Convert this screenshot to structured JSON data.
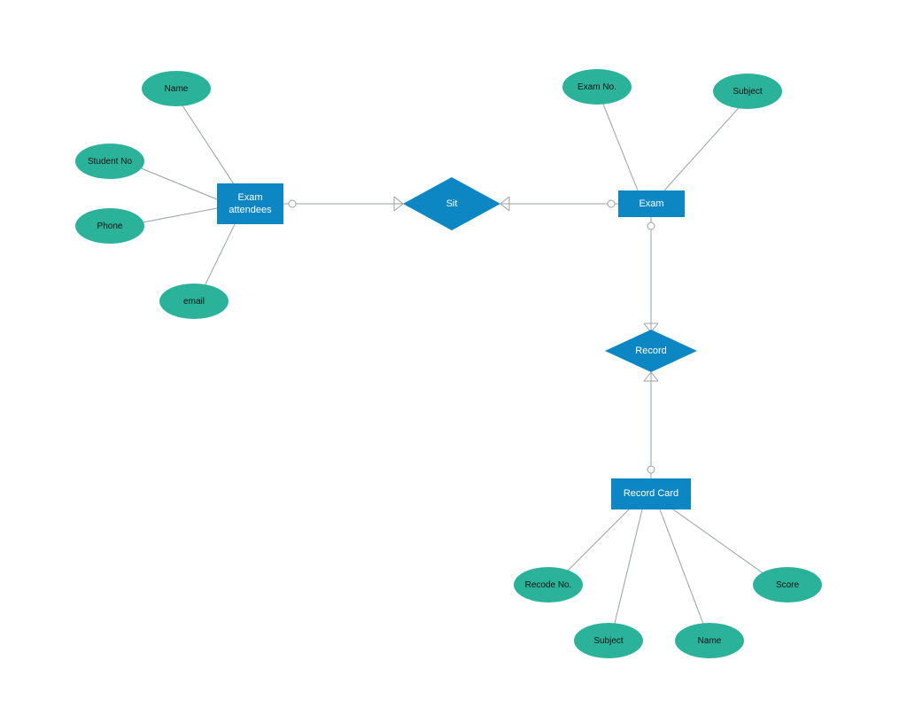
{
  "entities": {
    "examAttendees": "Exam attendees",
    "exam": "Exam",
    "recordCard": "Record Card"
  },
  "relationships": {
    "sit": "Sit",
    "record": "Record"
  },
  "attributes": {
    "examAttendees": {
      "name": "Name",
      "studentNo": "Student No",
      "phone": "Phone",
      "email": "email"
    },
    "exam": {
      "examNo": "Exam No.",
      "subject": "Subject"
    },
    "recordCard": {
      "recodeNo": "Recode No.",
      "subject": "Subject",
      "name": "Name",
      "score": "Score"
    }
  },
  "colors": {
    "entity": "#0d86c4",
    "relationship": "#0d86c4",
    "attribute": "#2bb29a",
    "line": "#9aa0a6"
  }
}
